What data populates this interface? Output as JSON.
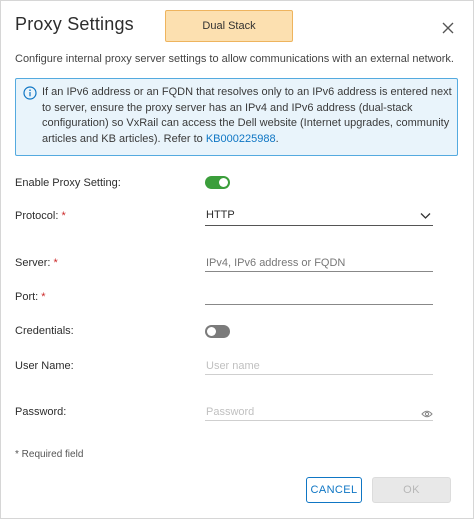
{
  "dialog": {
    "title": "Proxy Settings",
    "badge": "Dual Stack",
    "description": "Configure internal proxy server settings to allow communications with an external network."
  },
  "alert": {
    "text": "If an IPv6 address or an FQDN that resolves only to an IPv6 address is entered next to server, ensure the proxy server has an IPv4 and IPv6 address (dual-stack configuration) so VxRail can access the Dell website (Internet upgrades, community articles and KB articles).  Refer to ",
    "link": "KB000225988",
    "after_link": "."
  },
  "form": {
    "enable_proxy": {
      "label": "Enable Proxy Setting:",
      "on": true
    },
    "protocol": {
      "label": "Protocol:",
      "required_mark": "*",
      "value": "HTTP"
    },
    "server": {
      "label": "Server:",
      "required_mark": "*",
      "placeholder": "IPv4, IPv6 address or FQDN",
      "value": ""
    },
    "port": {
      "label": "Port:",
      "required_mark": "*",
      "value": ""
    },
    "credentials": {
      "label": "Credentials:",
      "on": false
    },
    "user_name": {
      "label": "User Name:",
      "placeholder": "User name"
    },
    "password": {
      "label": "Password:",
      "placeholder": "Password"
    },
    "required_note": "* Required field"
  },
  "actions": {
    "cancel": "CANCEL",
    "ok": "OK"
  },
  "colors": {
    "badge_bg": "#fce0b0",
    "alert_border": "#54aadf",
    "toggle_on": "#3b9e3b",
    "primary": "#0f76c4"
  },
  "icons": {
    "close": "close-icon",
    "info": "info-icon",
    "chevron": "chevron-down-icon",
    "eye": "eye-icon"
  }
}
